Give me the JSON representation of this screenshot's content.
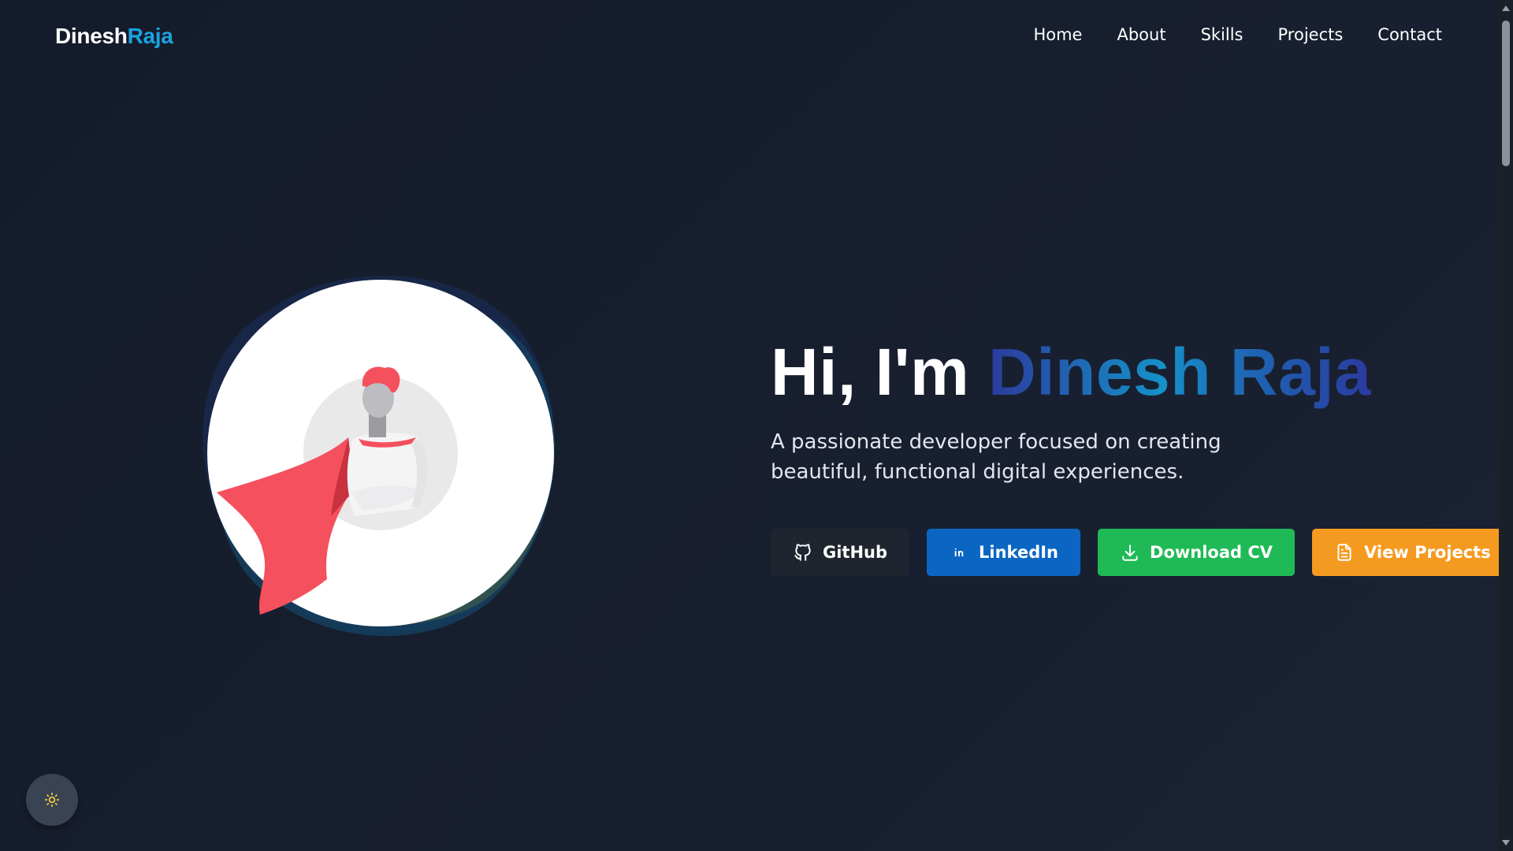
{
  "nav": {
    "logo_first": "Dinesh",
    "logo_second": "Raja",
    "links": [
      "Home",
      "About",
      "Skills",
      "Projects",
      "Contact"
    ]
  },
  "hero": {
    "greeting": "Hi, I'm",
    "name": "Dinesh Raja",
    "tagline": "A passionate developer focused on creating beautiful, functional digital experiences."
  },
  "buttons": {
    "github": "GitHub",
    "linkedin": "LinkedIn",
    "download_cv": "Download CV",
    "view_projects": "View Projects"
  },
  "icons": {
    "github": "github-icon",
    "linkedin": "linkedin-icon",
    "download": "download-icon",
    "document": "document-icon",
    "theme": "sun-icon"
  },
  "colors": {
    "background": "#171e2e",
    "accent": "#1aa3e0",
    "github_button": "#1f252e",
    "linkedin_button": "#0a66c2",
    "cv_button": "#1fba55",
    "projects_button": "#f59a20",
    "cape": "#f5505e"
  }
}
